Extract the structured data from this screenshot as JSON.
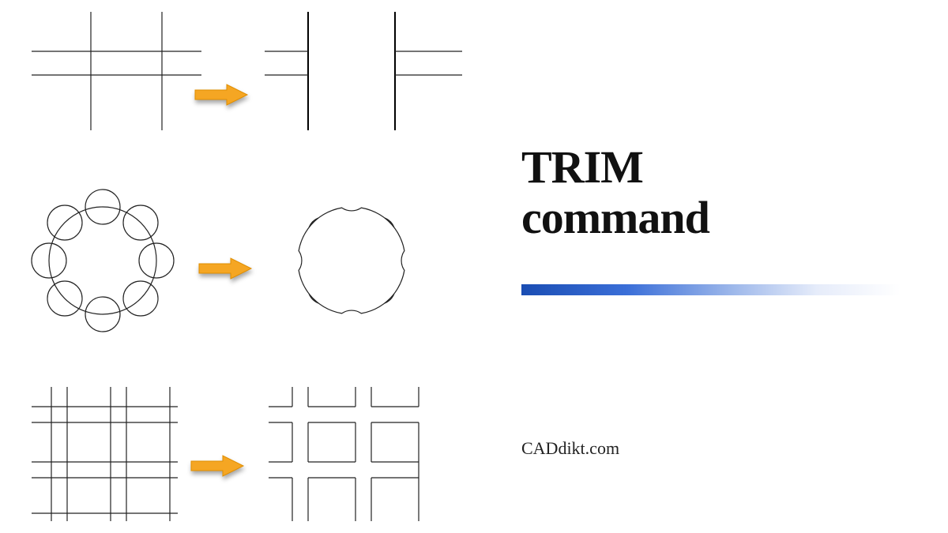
{
  "title_line1": "TRIM",
  "title_line2": "command",
  "credit": "CADdikt.com",
  "arrow_color": "#f5a623",
  "accent_gradient_start": "#1a4db3",
  "diagrams": [
    {
      "name": "grid-lines-trim",
      "description": "Crossing horizontal and vertical lines trimmed at intersections"
    },
    {
      "name": "circle-gear-trim",
      "description": "Ring of 8 small circles on a large circle trimmed into gear outline"
    },
    {
      "name": "grid-intersection-trim",
      "description": "Dense grid lines trimmed to leave openings at crossings"
    }
  ]
}
